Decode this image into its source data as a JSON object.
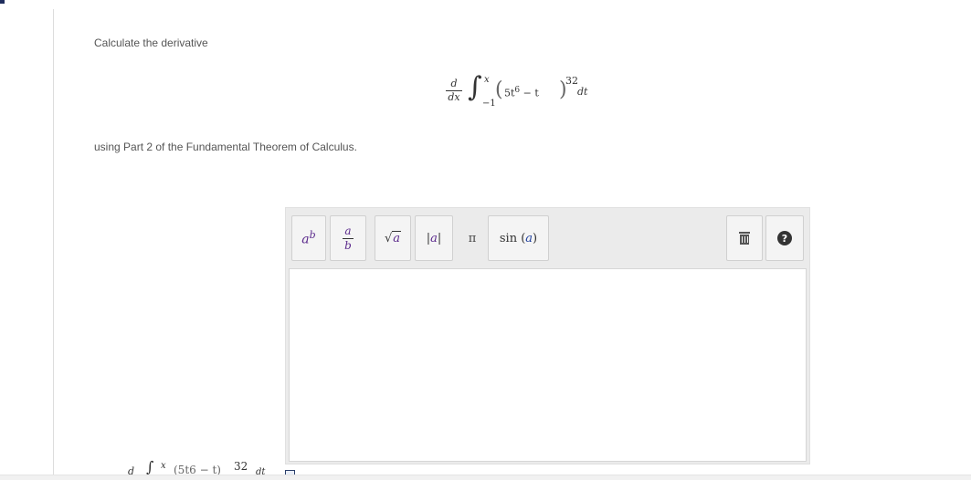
{
  "question": {
    "prompt_start": "Calculate the derivative",
    "prompt_end": "using Part 2 of the Fundamental Theorem of Calculus."
  },
  "formula": {
    "d_num": "d",
    "d_den": "dx",
    "integral_sign": "∫",
    "upper_limit": "x",
    "lower_limit": "−1",
    "paren_open": "(",
    "paren_close": ")",
    "integrand_coeff": "5t",
    "integrand_power": "6",
    "integrand_rest": " − t",
    "outer_exponent": "32",
    "differential": "dt"
  },
  "toolbar": {
    "power_base": "a",
    "power_exp": "b",
    "frac_num": "a",
    "frac_den": "b",
    "sqrt_symbol": "√",
    "sqrt_arg": "a",
    "abs_left": "|",
    "abs_arg": "a",
    "abs_right": "|",
    "pi_symbol": "π",
    "sin_func": "sin",
    "sin_open": "(",
    "sin_arg": "a",
    "sin_close": ")",
    "help_symbol": "?"
  },
  "preview": {
    "d_frac": "d",
    "integral_sign": "∫",
    "upper_limit": "x",
    "fragment": "(5t6 − t)",
    "exponent": "32",
    "differential": "dt"
  },
  "colors": {
    "text": "#555555",
    "toolbar_bg": "#ebebeb",
    "variable_purple": "#5b2a8c",
    "variable_blue": "#1f3f9c"
  }
}
